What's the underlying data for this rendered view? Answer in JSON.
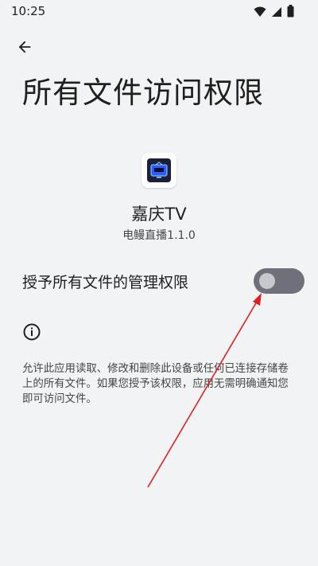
{
  "status_bar": {
    "time": "10:25",
    "icons": [
      "wifi-icon",
      "signal-icon",
      "battery-icon"
    ]
  },
  "header": {
    "back_icon": "arrow-back-icon",
    "title": "所有文件访问权限"
  },
  "app": {
    "icon": "app-tv-icon",
    "name": "嘉庆TV",
    "version": "电鳗直播1.1.0"
  },
  "permission": {
    "label": "授予所有文件的管理权限",
    "enabled": false
  },
  "info": {
    "icon": "info-icon",
    "description": "允许此应用读取、修改和删除此设备或任何已连接存储卷上的所有文件。如果您授予该权限，应用无需明确通知您即可访问文件。"
  },
  "colors": {
    "background": "#f1f3f4",
    "toggle_track": "#6e7179",
    "toggle_thumb": "#c6c8cc",
    "annotation_arrow": "#e02020"
  }
}
